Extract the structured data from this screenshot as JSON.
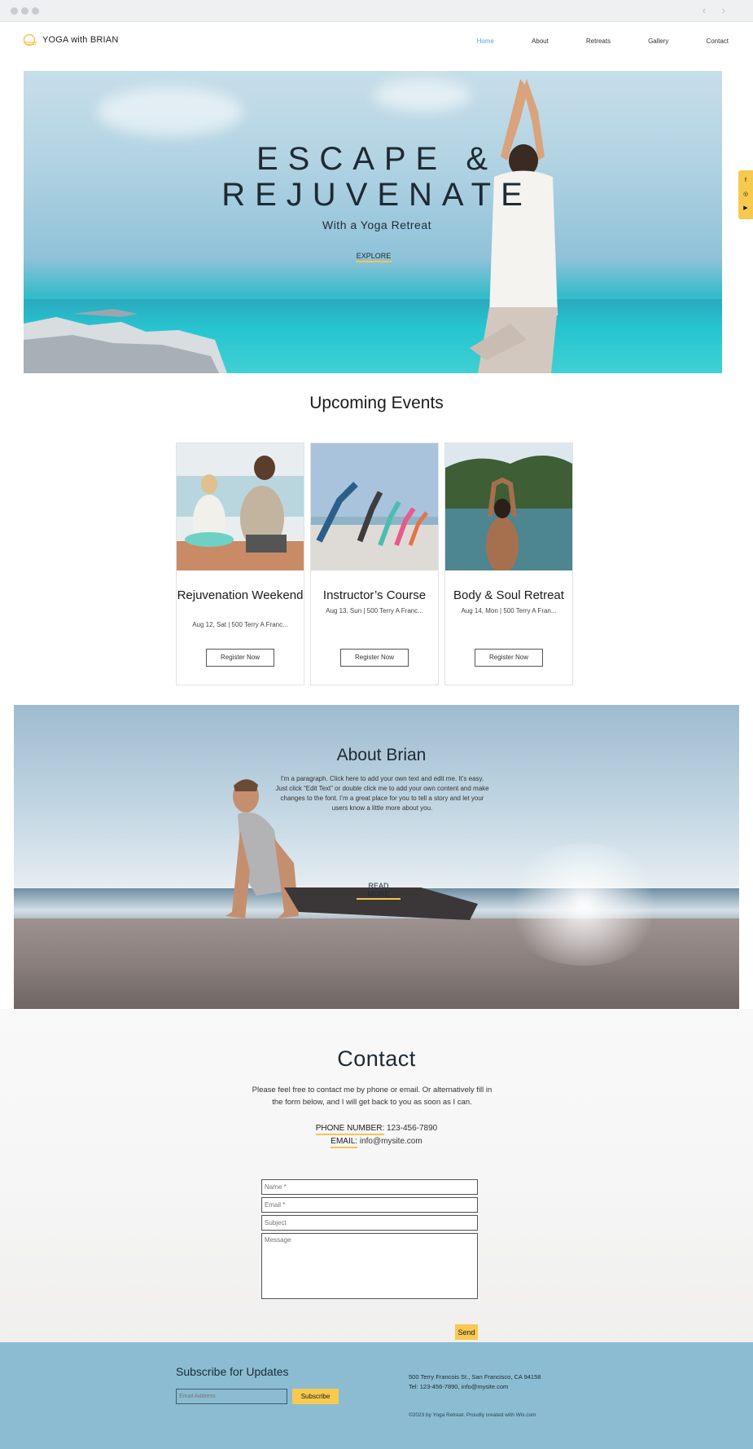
{
  "header": {
    "logo_text": "YOGA with BRIAN",
    "nav": [
      "Home",
      "About",
      "Retreats",
      "Gallery",
      "Contact"
    ],
    "active_nav": "Home"
  },
  "hero": {
    "title_line1": "ESCAPE &",
    "title_line2": "REJUVENATE",
    "subtitle": "With a Yoga Retreat",
    "button": "EXPLORE"
  },
  "social": [
    "facebook-icon",
    "instagram-icon",
    "youtube-icon"
  ],
  "events": {
    "title": "Upcoming Events",
    "items": [
      {
        "name": "Rejuvenation Weekend",
        "meta": "Aug 12, Sat | 500 Terry A Franc...",
        "button": "Register Now"
      },
      {
        "name": "Instructor’s Course",
        "meta": "Aug 13, Sun | 500 Terry A Franc...",
        "button": "Register Now"
      },
      {
        "name": "Body & Soul Retreat",
        "meta": "Aug 14, Mon | 500 Terry A Fran...",
        "button": "Register Now"
      }
    ]
  },
  "about": {
    "title": "About Brian",
    "text": "I'm a paragraph. Click here to add your own text and edit me. It’s easy. Just click “Edit Text” or double click me to add your own content and make changes to the font. I’m a great place for you to tell a story and let your users know a little more about you.",
    "button": "READ MORE"
  },
  "contact": {
    "title": "Contact",
    "text": "Please feel free to contact me by phone or email. Or alternatively fill in the form below, and I will get back to you as soon as I can.",
    "phone_label": "PHONE NUMBER:",
    "phone": "123-456-7890",
    "email_label": "EMAIL:",
    "email": "info@mysite.com",
    "placeholders": {
      "name": "Name *",
      "email": "Email *",
      "subject": "Subject",
      "message": "Message"
    },
    "send": "Send"
  },
  "footer": {
    "subscribe_title": "Subscribe for Updates",
    "email_placeholder": "Email Address",
    "subscribe_button": "Subscribe",
    "address": "500 Terry Francois St., San Francisco, CA 94158",
    "tel": "Tel: 123-456-7890, info@mysite.com",
    "copyright": "©2023 by Yoga Retreat. Proudly created with Wix.com"
  },
  "colors": {
    "accent": "#f7c94f",
    "nav_active": "#5ba4cf",
    "footer_bg": "#8bbcd2"
  }
}
